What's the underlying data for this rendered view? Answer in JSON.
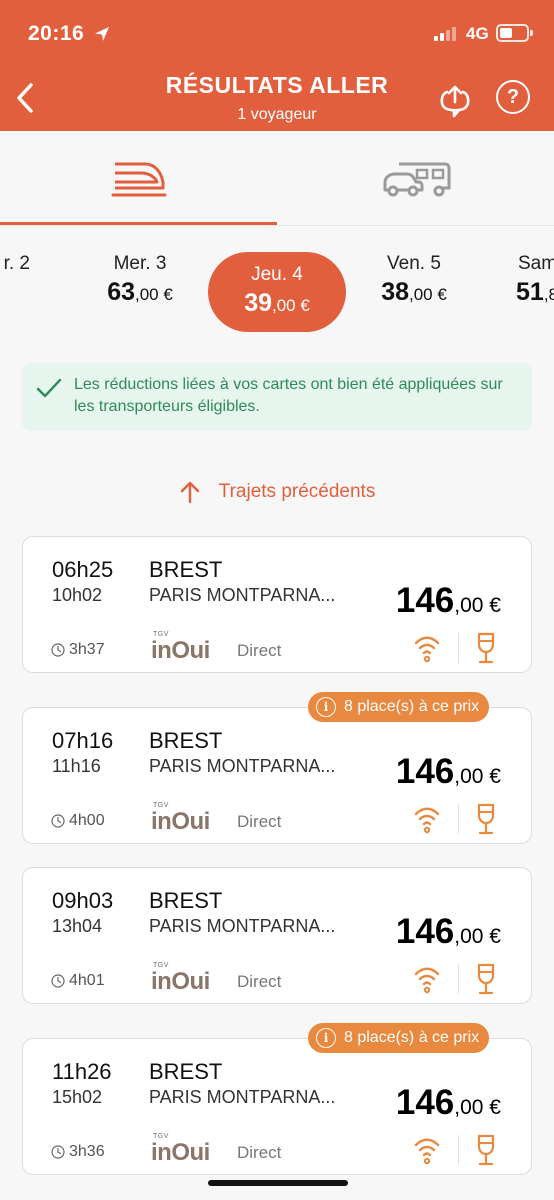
{
  "status_bar": {
    "time": "20:16",
    "network": "4G"
  },
  "header": {
    "title": "RÉSULTATS ALLER",
    "subtitle": "1 voyageur",
    "help_label": "?"
  },
  "tabs": [
    {
      "name": "train",
      "icon": "train-icon",
      "selected": true
    },
    {
      "name": "bus",
      "icon": "bus-car-icon",
      "selected": false
    }
  ],
  "dates": [
    {
      "label": "r. 2",
      "price_int": "-",
      "price_dec": ""
    },
    {
      "label": "Mer. 3",
      "price_int": "63",
      "price_dec": ",00 €"
    },
    {
      "label": "Jeu. 4",
      "price_int": "39",
      "price_dec": ",00 €",
      "selected": true
    },
    {
      "label": "Ven. 5",
      "price_int": "38",
      "price_dec": ",00 €"
    },
    {
      "label": "Sam",
      "price_int": "51",
      "price_dec": ",8"
    }
  ],
  "info_message": "Les réductions liées à vos cartes ont bien été appliquées sur les transporteurs éligibles.",
  "previous_trips_label": "Trajets précédents",
  "journeys": [
    {
      "dep_time": "06h25",
      "dep_station": "BREST",
      "arr_time": "10h02",
      "arr_station": "PARIS MONTPARNA...",
      "price_int": "146",
      "price_dec": ",00 €",
      "duration": "3h37",
      "brand_top": "TGV",
      "brand": "inOui",
      "type": "Direct",
      "badge": ""
    },
    {
      "dep_time": "07h16",
      "dep_station": "BREST",
      "arr_time": "11h16",
      "arr_station": "PARIS MONTPARNA...",
      "price_int": "146",
      "price_dec": ",00 €",
      "duration": "4h00",
      "brand_top": "TGV",
      "brand": "inOui",
      "type": "Direct",
      "badge": "8 place(s) à ce prix"
    },
    {
      "dep_time": "09h03",
      "dep_station": "BREST",
      "arr_time": "13h04",
      "arr_station": "PARIS MONTPARNA...",
      "price_int": "146",
      "price_dec": ",00 €",
      "duration": "4h01",
      "brand_top": "TGV",
      "brand": "inOui",
      "type": "Direct",
      "badge": ""
    },
    {
      "dep_time": "11h26",
      "dep_station": "BREST",
      "arr_time": "15h02",
      "arr_station": "PARIS MONTPARNA...",
      "price_int": "146",
      "price_dec": ",00 €",
      "duration": "3h36",
      "brand_top": "TGV",
      "brand": "inOui",
      "type": "Direct",
      "badge": "8 place(s) à ce prix"
    }
  ],
  "colors": {
    "accent": "#e15f3c",
    "badge": "#e8893f",
    "amenity": "#e8893f",
    "success": "#2e8a5a",
    "brand": "#8a7568"
  }
}
